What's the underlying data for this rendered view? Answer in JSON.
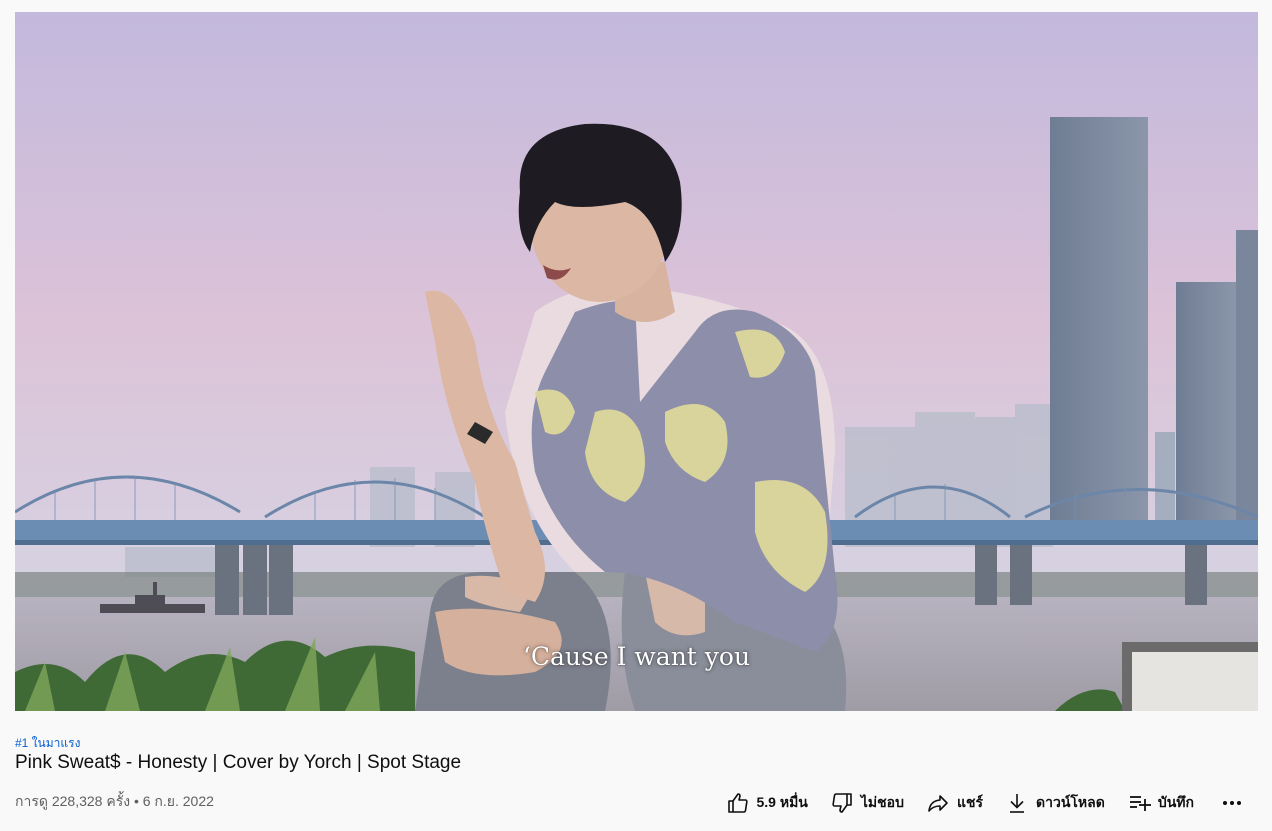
{
  "video": {
    "caption": "‘Cause I want you"
  },
  "trending_badge": "#1 ในมาแรง",
  "title": "Pink Sweat$ - Honesty | Cover by Yorch | Spot Stage",
  "meta": "การดู 228,328 ครั้ง • 6 ก.ย. 2022",
  "actions": {
    "like_count": "5.9 หมื่น",
    "dislike_label": "ไม่ชอบ",
    "share_label": "แชร์",
    "download_label": "ดาวน์โหลด",
    "save_label": "บันทึก"
  },
  "icons": {
    "like": "thumbs-up-icon",
    "dislike": "thumbs-down-icon",
    "share": "share-arrow-icon",
    "download": "download-icon",
    "save": "playlist-add-icon",
    "more": "more-horizontal-icon"
  }
}
